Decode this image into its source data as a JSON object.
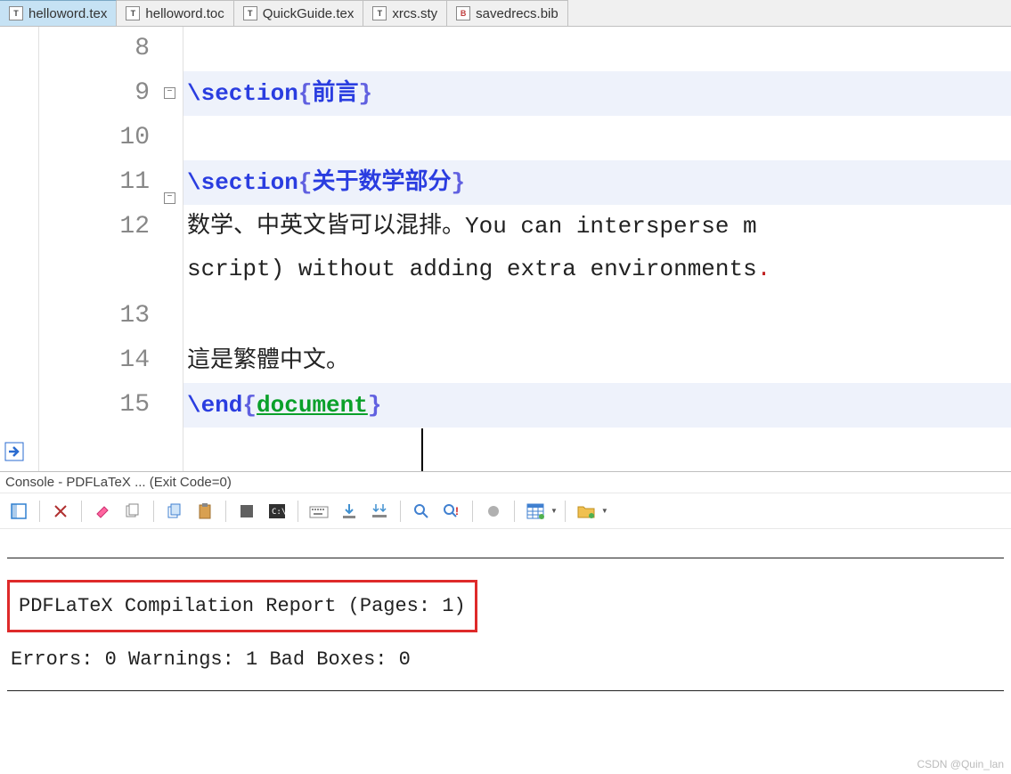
{
  "tabs": [
    {
      "label": "helloword.tex",
      "icon": "T",
      "active": true
    },
    {
      "label": "helloword.toc",
      "icon": "T",
      "active": false
    },
    {
      "label": "QuickGuide.tex",
      "icon": "T",
      "active": false
    },
    {
      "label": "xrcs.sty",
      "icon": "T",
      "active": false
    },
    {
      "label": "savedrecs.bib",
      "icon": "B",
      "active": false
    }
  ],
  "editor": {
    "lines": [
      {
        "num": "8",
        "type": "blank"
      },
      {
        "num": "9",
        "type": "section",
        "cmd": "\\section",
        "arg": "前言",
        "fold": true,
        "highlight": true
      },
      {
        "num": "10",
        "type": "blank"
      },
      {
        "num": "11",
        "type": "section",
        "cmd": "\\section",
        "arg": "关于数学部分",
        "fold": true,
        "highlight": true
      },
      {
        "num": "12",
        "type": "text",
        "text_pre": "数学、中英文皆可以混排。You can intersperse m",
        "text_wrap": "script) without adding extra environments",
        "punct": ".",
        "wrapped": true
      },
      {
        "num": "13",
        "type": "blank"
      },
      {
        "num": "14",
        "type": "text",
        "text_pre": "這是繁體中文。"
      },
      {
        "num": "15",
        "type": "end",
        "cmd": "\\end",
        "env": "document",
        "highlight": true
      }
    ]
  },
  "console": {
    "header": "Console - PDFLaTeX ... (Exit Code=0)",
    "report_title": "PDFLaTeX Compilation Report (Pages: 1)",
    "stats": "Errors: 0   Warnings: 1   Bad Boxes: 0"
  },
  "watermark": "CSDN @Quin_lan"
}
